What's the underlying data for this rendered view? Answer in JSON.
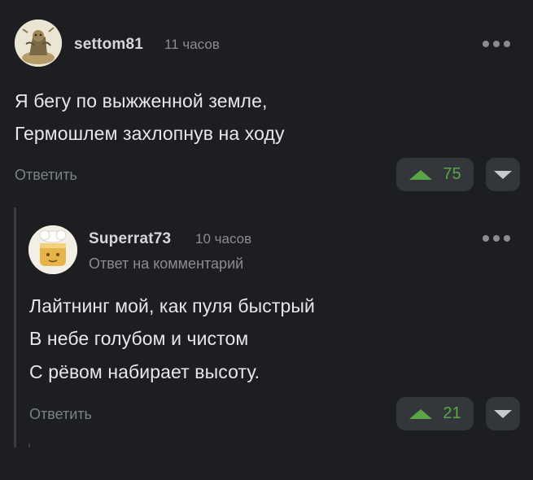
{
  "comment": {
    "author": "settom81",
    "time": "11 часов",
    "lines": [
      "Я бегу по выжженной земле,",
      "Гермошлем захлопнув на ходу"
    ],
    "reply_label": "Ответить",
    "votes": "75"
  },
  "reply": {
    "author": "Superrat73",
    "time": "10 часов",
    "subtitle": "Ответ на комментарий",
    "lines": [
      "Лайтнинг мой, как пуля быстрый",
      "В небе голубом и чистом",
      "С рёвом набирает высоту."
    ],
    "reply_label": "Ответить",
    "votes": "21"
  },
  "colors": {
    "background": "#1d1e21",
    "upvote_green": "#5aa646",
    "button_bg": "#33363b"
  },
  "icons": {
    "more": "more-dots-icon",
    "upvote": "triangle-up-icon",
    "downvote": "triangle-down-icon"
  }
}
